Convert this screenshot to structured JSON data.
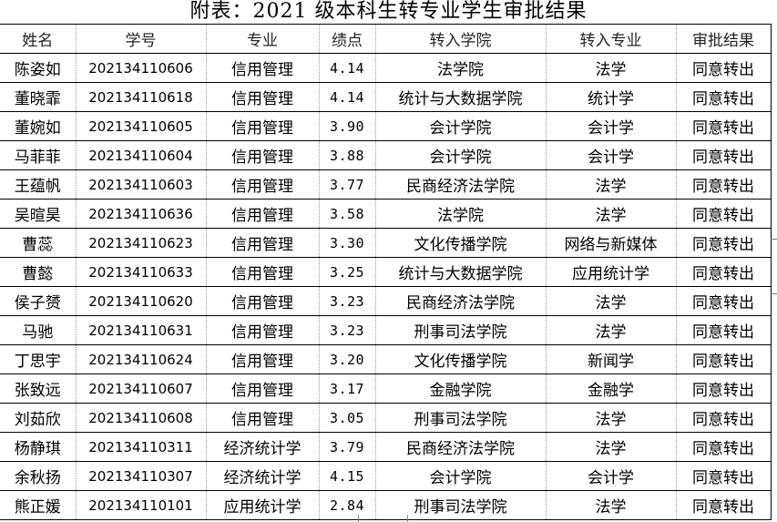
{
  "title": "附表：2021 级本科生转专业学生审批结果",
  "columns": [
    "姓名",
    "学号",
    "专业",
    "绩点",
    "转入学院",
    "转入专业",
    "审批结果"
  ],
  "rows": [
    [
      "陈姿如",
      "202134110606",
      "信用管理",
      "4.14",
      "法学院",
      "法学",
      "同意转出"
    ],
    [
      "董晓霏",
      "202134110618",
      "信用管理",
      "4.14",
      "统计与大数据学院",
      "统计学",
      "同意转出"
    ],
    [
      "董婉如",
      "202134110605",
      "信用管理",
      "3.90",
      "会计学院",
      "会计学",
      "同意转出"
    ],
    [
      "马菲菲",
      "202134110604",
      "信用管理",
      "3.88",
      "会计学院",
      "会计学",
      "同意转出"
    ],
    [
      "王蕴帆",
      "202134110603",
      "信用管理",
      "3.77",
      "民商经济法学院",
      "法学",
      "同意转出"
    ],
    [
      "吴暄昊",
      "202134110636",
      "信用管理",
      "3.58",
      "法学院",
      "法学",
      "同意转出"
    ],
    [
      "曹蕊",
      "202134110623",
      "信用管理",
      "3.30",
      "文化传播学院",
      "网络与新媒体",
      "同意转出"
    ],
    [
      "曹懿",
      "202134110633",
      "信用管理",
      "3.25",
      "统计与大数据学院",
      "应用统计学",
      "同意转出"
    ],
    [
      "侯子赟",
      "202134110620",
      "信用管理",
      "3.23",
      "民商经济法学院",
      "法学",
      "同意转出"
    ],
    [
      "马驰",
      "202134110631",
      "信用管理",
      "3.23",
      "刑事司法学院",
      "法学",
      "同意转出"
    ],
    [
      "丁思宇",
      "202134110624",
      "信用管理",
      "3.20",
      "文化传播学院",
      "新闻学",
      "同意转出"
    ],
    [
      "张致远",
      "202134110607",
      "信用管理",
      "3.17",
      "金融学院",
      "金融学",
      "同意转出"
    ],
    [
      "刘茹欣",
      "202134110608",
      "信用管理",
      "3.05",
      "刑事司法学院",
      "法学",
      "同意转出"
    ],
    [
      "杨静琪",
      "202134110311",
      "经济统计学",
      "3.79",
      "民商经济法学院",
      "法学",
      "同意转出"
    ],
    [
      "余秋扬",
      "202134110307",
      "经济统计学",
      "4.15",
      "会计学院",
      "会计学",
      "同意转出"
    ],
    [
      "熊正媛",
      "202134110101",
      "应用统计学",
      "2.84",
      "刑事司法学院",
      "法学",
      "同意转出"
    ]
  ]
}
